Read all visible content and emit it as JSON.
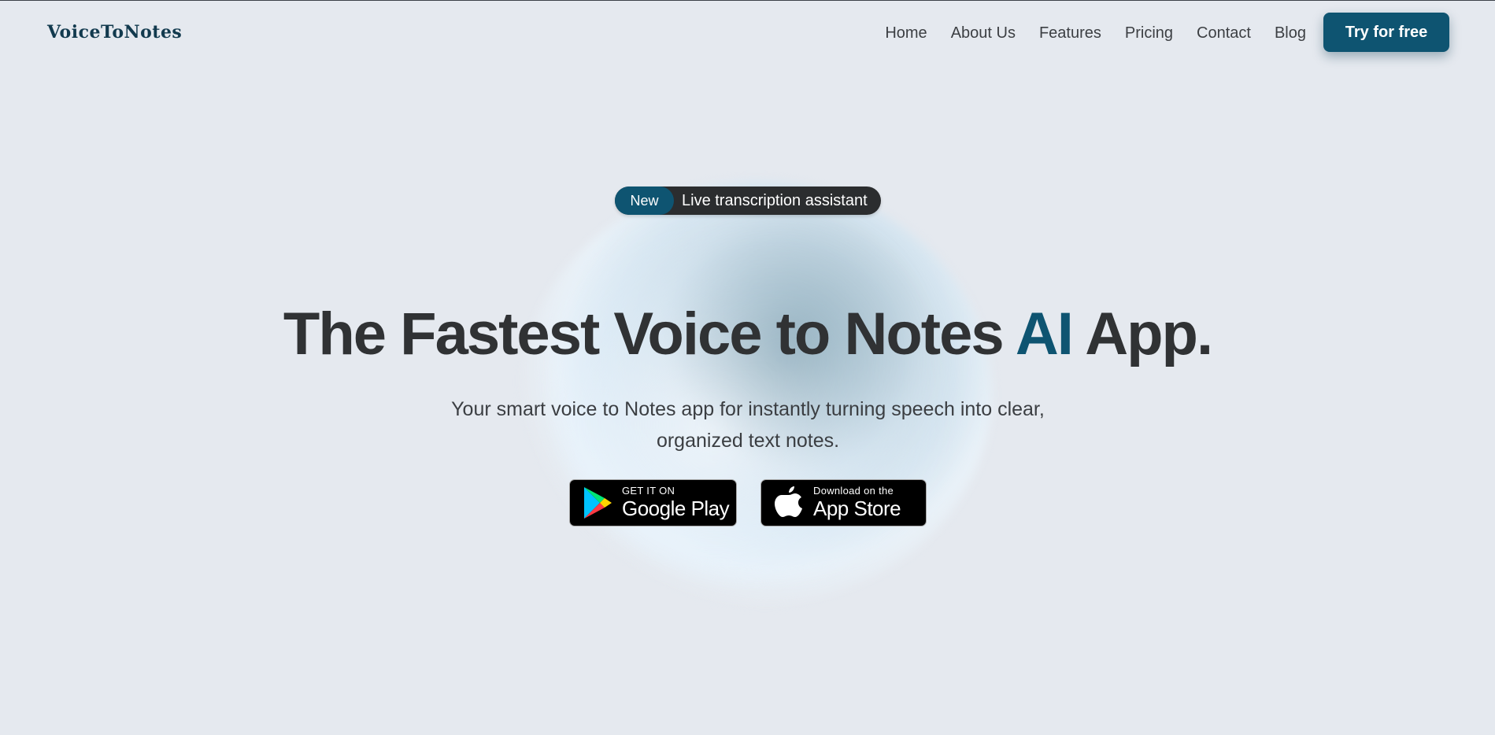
{
  "header": {
    "logo": "VoiceToNotes",
    "nav": [
      "Home",
      "About Us",
      "Features",
      "Pricing",
      "Contact",
      "Blog"
    ],
    "cta_label": "Try for free"
  },
  "hero": {
    "badge_tag": "New",
    "badge_text": "Live transcription assistant",
    "headline_part1": "The Fastest Voice to Notes ",
    "headline_highlight": "AI",
    "headline_part2": " App.",
    "subtitle": "Your smart voice to Notes app for instantly turning speech into clear, organized text notes."
  },
  "store_buttons": {
    "google": {
      "small": "GET IT ON",
      "big": "Google Play",
      "icon": "google-play-icon"
    },
    "apple": {
      "small": "Download on the",
      "big": "App Store",
      "icon": "apple-icon"
    }
  },
  "colors": {
    "accent": "#0e5471",
    "background": "#e5e9ef",
    "text": "#303234"
  }
}
